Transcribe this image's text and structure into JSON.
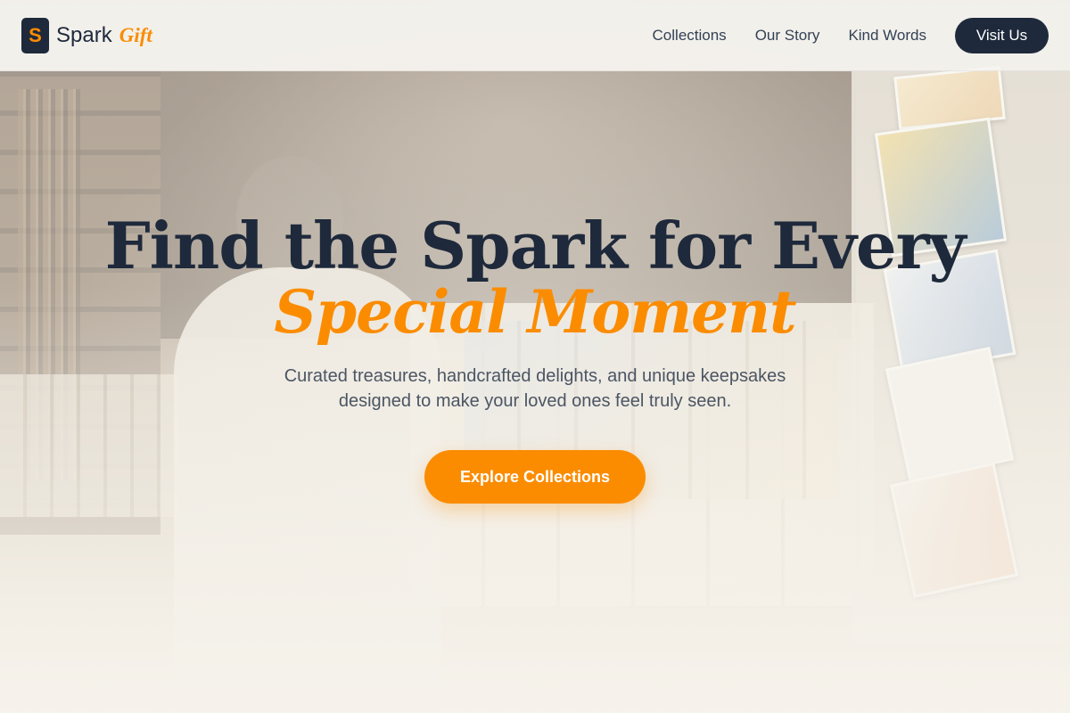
{
  "brand": {
    "logo_letter": "S",
    "name": "Spark",
    "accent_word": "Gift"
  },
  "nav": {
    "links": [
      "Collections",
      "Our Story",
      "Kind Words"
    ],
    "cta_label": "Visit Us"
  },
  "hero": {
    "title_line1": "Find the Spark for Every",
    "title_line2": "Special Moment",
    "subtitle_line1": "Curated treasures, handcrafted delights, and unique keepsakes",
    "subtitle_line2": "designed to make your loved ones feel truly seen.",
    "cta_label": "Explore Collections",
    "background_image": "gift-shop-interior-photo"
  },
  "colors": {
    "primary_dark": "#1e293b",
    "accent_orange": "#fb8c00",
    "background": "#f6f3ec"
  }
}
